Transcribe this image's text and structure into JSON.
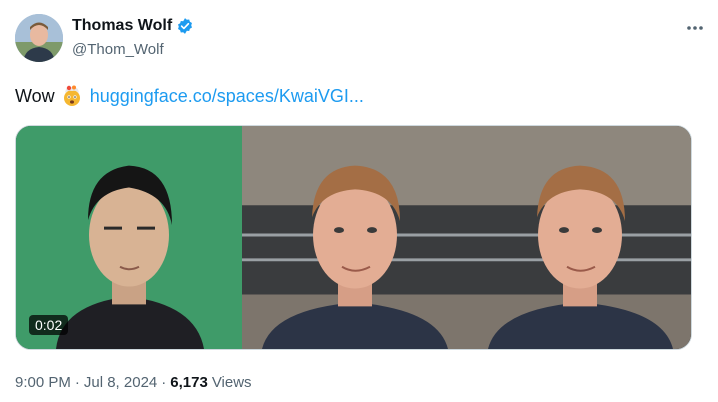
{
  "author": {
    "display_name": "Thomas Wolf",
    "handle": "@Thom_Wolf",
    "verified": true
  },
  "tweet": {
    "text": "Wow",
    "emoji": "exploding-head-emoji",
    "link_text": "huggingface.co/spaces/KwaiVGI..."
  },
  "media": {
    "duration": "0:02",
    "panels": [
      "source-portrait-green-background",
      "driving-video-frame",
      "result-video-frame"
    ]
  },
  "meta": {
    "time": "9:00 PM",
    "separator": "·",
    "date": "Jul 8, 2024",
    "views_count": "6,173",
    "views_label": "Views"
  },
  "colors": {
    "link": "#1d9bf0",
    "verified_badge": "#1d9bf0",
    "secondary_text": "#536471",
    "green_screen": "#3f9b69"
  }
}
